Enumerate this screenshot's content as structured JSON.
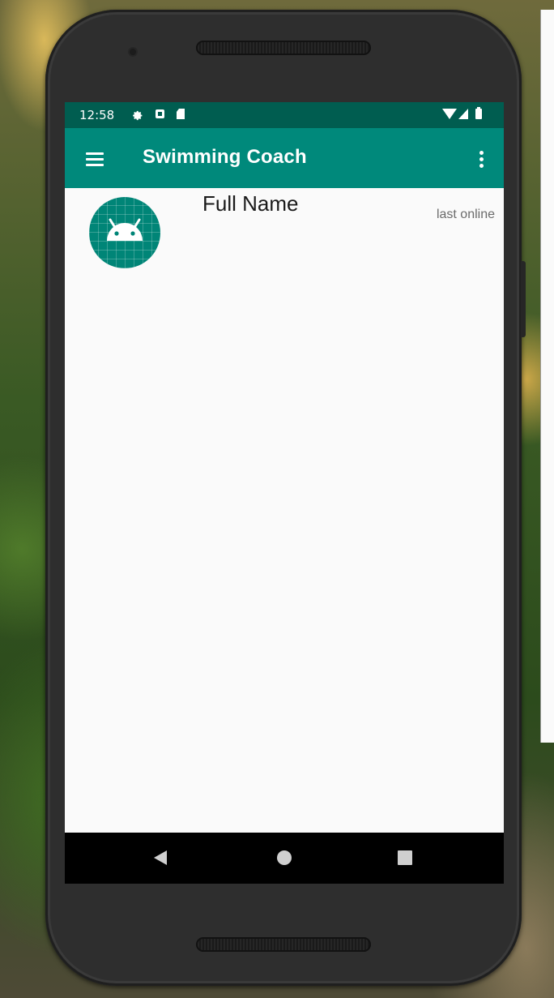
{
  "status_bar": {
    "time": "12:58",
    "left_icons": [
      "settings-icon",
      "app-notification-icon",
      "sd-card-icon"
    ],
    "right_icons": [
      "wifi-icon",
      "cell-signal-icon",
      "battery-icon"
    ],
    "background_color": "#005d50"
  },
  "toolbar": {
    "title": "Swimming Coach",
    "menu_icon": "hamburger-menu-icon",
    "overflow_icon": "more-vert-icon",
    "background_color": "#00897b"
  },
  "contact_list": [
    {
      "avatar_icon": "android-icon",
      "name": "Full Name",
      "status": "last online"
    }
  ],
  "nav_bar": {
    "buttons": [
      "back-icon",
      "home-icon",
      "recents-icon"
    ]
  },
  "colors": {
    "accent": "#008577",
    "screen_background": "#fafafa"
  }
}
